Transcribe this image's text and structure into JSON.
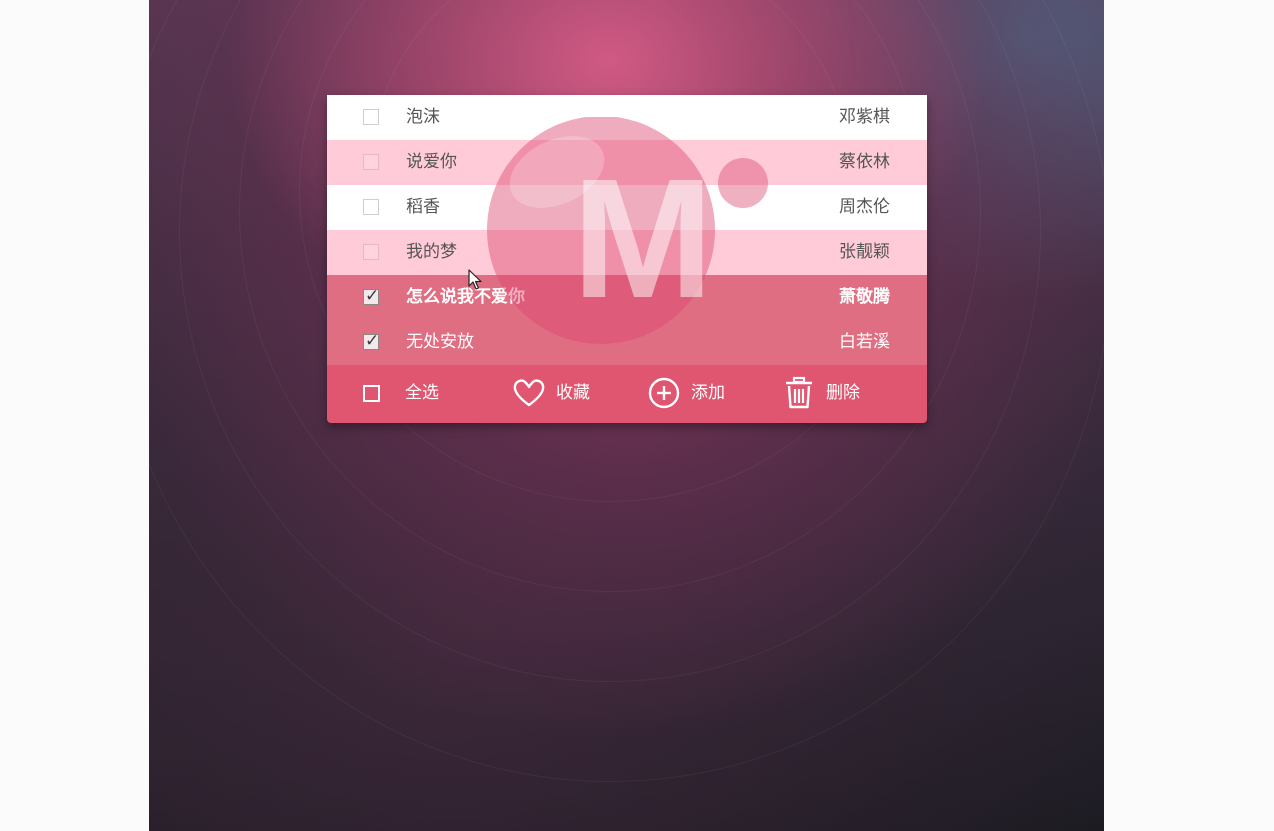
{
  "songs": [
    {
      "title": "泡沫",
      "artist": "邓紫棋",
      "checked": false
    },
    {
      "title": "说爱你",
      "artist": "蔡依林",
      "checked": false
    },
    {
      "title": "稻香",
      "artist": "周杰伦",
      "checked": false
    },
    {
      "title": "我的梦",
      "artist": "张靓颖",
      "checked": false
    },
    {
      "title": "怎么说我不爱你",
      "artist": "萧敬腾",
      "checked": true
    },
    {
      "title": "无处安放",
      "artist": "白若溪",
      "checked": true
    }
  ],
  "footer": {
    "select_all_label": "全选",
    "favorite_label": "收藏",
    "add_label": "添加",
    "delete_label": "删除"
  },
  "logo": {
    "letter": "M"
  },
  "colors": {
    "accent": "#e0556f",
    "row_pink": "#ffcbd8",
    "row_checked": "#e06e82"
  },
  "icons": {
    "favorite": "heart-icon",
    "add": "plus-circle-icon",
    "delete": "trash-icon"
  }
}
